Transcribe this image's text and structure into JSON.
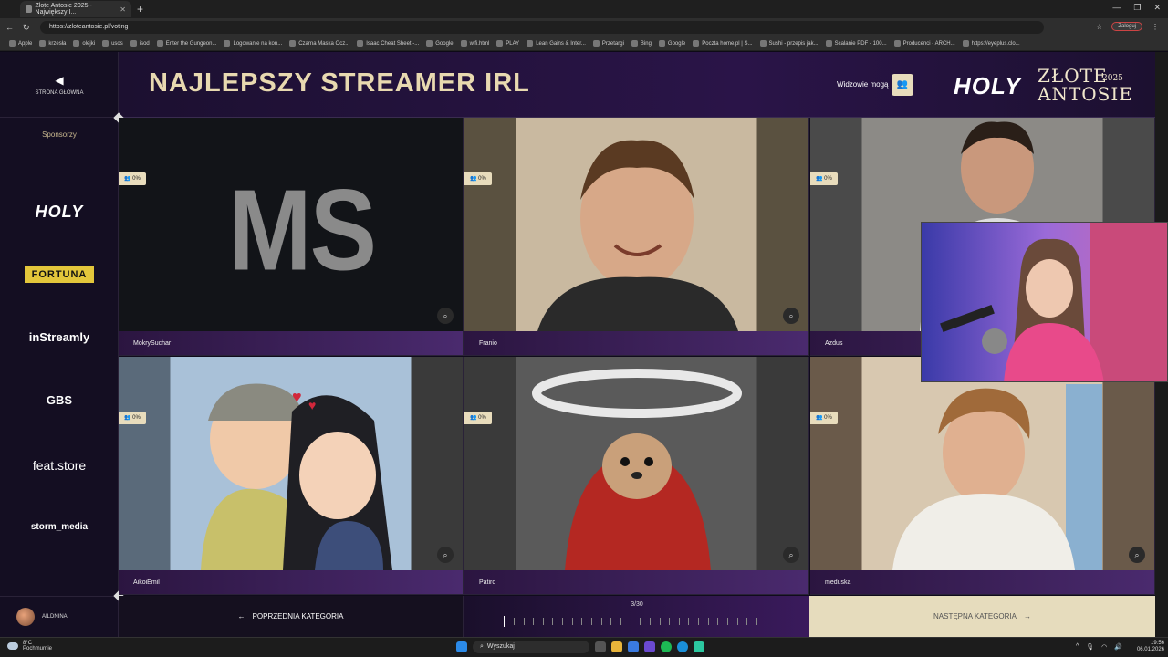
{
  "browser": {
    "tab_title": "Złote Antosie 2025 - Największy I...",
    "url": "https://zloteantosie.pl/voting",
    "profile_label": "Zaloguj",
    "bookmarks": [
      "Apple",
      "krzesła",
      "olejki",
      "usos",
      "isod",
      "Enter the Gungeon...",
      "Logowanie na kon...",
      "Czarna Maska Ocz...",
      "Isaac Cheat Sheet -...",
      "Google",
      "wifi.html",
      "PLAY",
      "Lean Gains & Inter...",
      "Przetargi",
      "Bing",
      "Google",
      "Poczta home.pl | S...",
      "Sushi - przepis jak...",
      "Scalanie PDF - 100...",
      "Producenci - ARCH...",
      "https://eyeplus.clo..."
    ]
  },
  "sidebar": {
    "home_label": "STRONA GŁÓWNA",
    "sponsors_title": "Sponsorzy",
    "sponsors": [
      "HOLY",
      "FORTUNA",
      "inStreamly",
      "GBS",
      "feat.store",
      "storm_media"
    ],
    "user_name": "AILDNINA"
  },
  "header": {
    "title": "NAJLEPSZY STREAMER IRL",
    "viewers_label": "Widzowie mogą",
    "brand_holy": "HOLY",
    "brand_zlote": "ZŁOTE",
    "brand_antosie": "ANTOSIE",
    "brand_year": "2025"
  },
  "cards": [
    {
      "name": "MokrySuchar",
      "percent": "0%",
      "placeholder": "MS"
    },
    {
      "name": "Franio",
      "percent": "0%"
    },
    {
      "name": "Azdus",
      "percent": "0%"
    },
    {
      "name": "AikoiEmil",
      "percent": "0%"
    },
    {
      "name": "Patiro",
      "percent": "0%"
    },
    {
      "name": "meduska",
      "percent": "0%"
    }
  ],
  "footer": {
    "prev_label": "POPRZEDNIA KATEGORIA",
    "next_label": "NASTĘPNA KATEGORIA",
    "progress_label": "3/30",
    "progress_current": 3,
    "progress_total": 30
  },
  "taskbar": {
    "temperature": "8°C",
    "weather": "Pochmurnie",
    "search_placeholder": "Wyszukaj",
    "time": "19:56",
    "date": "06.01.2026"
  }
}
